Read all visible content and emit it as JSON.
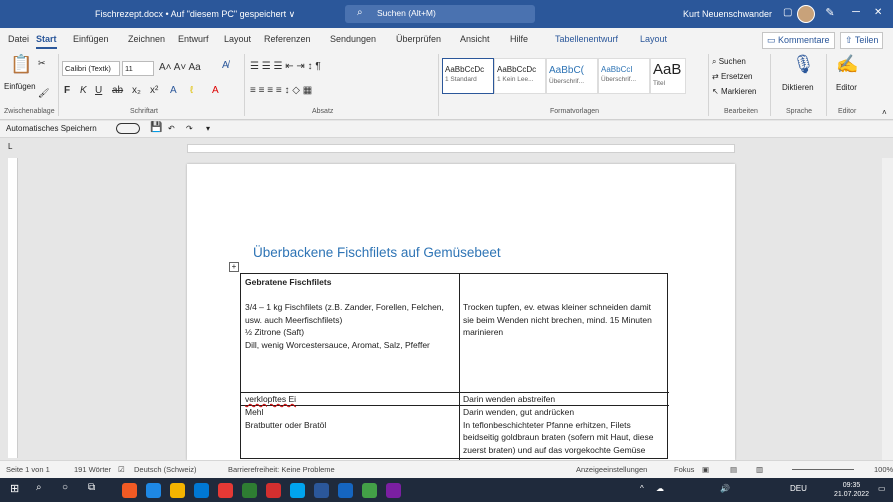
{
  "window": {
    "title": "Fischrezept.docx • Auf \"diesem PC\" gespeichert ∨",
    "search_placeholder": "Suchen (Alt+M)",
    "user": "Kurt Neuenschwander",
    "controls": [
      "─",
      "▢",
      "✕"
    ]
  },
  "tabs": [
    "Datei",
    "Start",
    "Einfügen",
    "Zeichnen",
    "Entwurf",
    "Layout",
    "Referenzen",
    "Sendungen",
    "Überprüfen",
    "Ansicht",
    "Hilfe",
    "Tabellenentwurf",
    "Layout"
  ],
  "active_tab": "Start",
  "comments_label": "Kommentare",
  "share_label": "Teilen",
  "ribbon": {
    "paste_label": "Einfügen",
    "font_name": "Calibri (Textk)",
    "font_size": "11",
    "groups": [
      "Zwischenablage",
      "Schriftart",
      "Absatz",
      "Formatvorlagen",
      "Bearbeiten",
      "Sprache",
      "Editor"
    ],
    "styles": [
      {
        "sample": "AaBbCcDc",
        "name": "1 Standard"
      },
      {
        "sample": "AaBbCcDc",
        "name": "1 Kein Lee..."
      },
      {
        "sample": "AaBbC(",
        "name": "Überschrif..."
      },
      {
        "sample": "AaBbCcI",
        "name": "Überschrif..."
      },
      {
        "sample": "AaB",
        "name": "Titel"
      }
    ],
    "edit": [
      "Suchen",
      "Ersetzen",
      "Markieren"
    ],
    "dictate": "Diktieren",
    "editor": "Editor"
  },
  "qat": {
    "autosave": "Automatisches Speichern"
  },
  "document": {
    "title": "Überbackene Fischfilets auf Gemüsebeet",
    "table": {
      "header": "Gebratene Fischfilets",
      "rows": [
        {
          "left": "3/4 – 1 kg Fischfilets (z.B. Zander, Forellen, Felchen, usw. auch Meerfischfilets)\n½ Zitrone (Saft)\nDill, wenig Worcestersauce, Aromat, Salz, Pfeffer",
          "right": "Trocken tupfen, ev. etwas kleiner schneiden damit sie beim Wenden nicht brechen, mind. 15 Minuten marinieren"
        },
        {
          "left": "verklopftes Ei",
          "right": "Darin wenden abstreifen"
        },
        {
          "left": "Mehl\nBratbutter oder Bratöl",
          "right": "Darin wenden, gut andrücken\nIn teflonbeschichteter Pfanne erhitzen, Filets beidseitig goldbraun braten (sofern mit Haut, diese zuerst braten) und auf das vorgekochte Gemüse anrichten"
        }
      ]
    }
  },
  "status": {
    "page": "Seite 1 von 1",
    "words": "191 Wörter",
    "language": "Deutsch (Schweiz)",
    "accessibility": "Barrierefreiheit: Keine Probleme",
    "display": "Anzeigeeinstellungen",
    "focus": "Fokus",
    "zoom": "100%"
  },
  "taskbar": {
    "lang": "DEU",
    "time": "09:35",
    "date": "21.07.2022",
    "colors": [
      "#f15a24",
      "#1e88e5",
      "#f4b400",
      "#0078d4",
      "#e53935",
      "#2e7d32",
      "#d32f2f",
      "#00a4ef",
      "#2b579a",
      "#1565c0",
      "#43a047",
      "#7b1fa2"
    ]
  }
}
